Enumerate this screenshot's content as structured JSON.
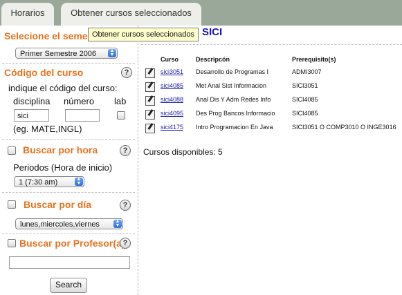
{
  "tabs": [
    {
      "label": "Horarios"
    },
    {
      "label": "Obtener cursos seleccionados"
    }
  ],
  "tooltip": "Obtener cursos seleccionados",
  "sidebar": {
    "semester": {
      "title": "Selecione el semestre",
      "selected": "Primer Semestre 2006"
    },
    "course_code": {
      "title": "Código del curso",
      "instruction": "indique el código del curso:",
      "col_disciplina": "disciplina",
      "col_numero": "número",
      "col_lab": "lab",
      "disciplina_value": "sici",
      "numero_value": "",
      "example": "(eg. MATE,INGL)"
    },
    "by_hour": {
      "title": "Buscar por hora",
      "label": "Periodos (Hora de inicio)",
      "selected": "1 (7:30 am)"
    },
    "by_day": {
      "title": "Buscar por día",
      "selected": "lunes,miercoles,viernes"
    },
    "by_professor": {
      "title": "Buscar por Profesor(a)",
      "value": ""
    },
    "search_button": "Search",
    "help": "?"
  },
  "main": {
    "title": "SICI",
    "headers": {
      "curso": "Curso",
      "descripcion": "Descripcón",
      "prerequisito": "Prerequisito(s)"
    },
    "rows": [
      {
        "code": "sici3051",
        "desc": "Desarrollo de Programas I",
        "pre": "ADMI3007"
      },
      {
        "code": "sici4085",
        "desc": "Met Anal Sist Informacion",
        "pre": "SICI3051"
      },
      {
        "code": "sici4088",
        "desc": "Anal Dis Y Adm Redes Info",
        "pre": "SICI4085"
      },
      {
        "code": "sici4095",
        "desc": "Des Prog Bancos Informacio",
        "pre": "SICI4085"
      },
      {
        "code": "sici4175",
        "desc": "Intro Programacion En Java",
        "pre": "SICI3051 O COMP3010 O INGE3016"
      }
    ],
    "available": "Cursos disponibles: 5"
  },
  "colors": {
    "accent": "#e8731f",
    "title_blue": "#1414c8",
    "topbar": "#9aa89a"
  }
}
